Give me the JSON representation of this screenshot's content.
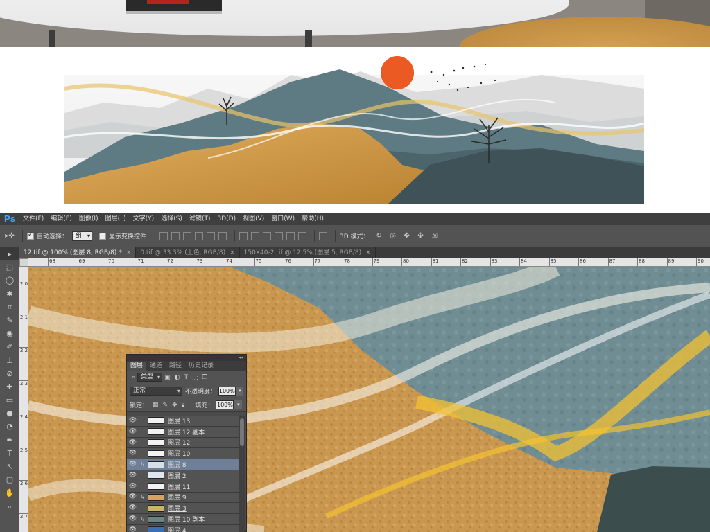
{
  "app": {
    "logo": "Ps"
  },
  "menu": [
    "文件(F)",
    "编辑(E)",
    "图像(I)",
    "图层(L)",
    "文字(Y)",
    "选择(S)",
    "滤镜(T)",
    "3D(D)",
    "视图(V)",
    "窗口(W)",
    "帮助(H)"
  ],
  "options_bar": {
    "auto_select_label": "自动选择：",
    "auto_select_value": "组",
    "show_transform_label": "显示变换控件",
    "mode3d_label": "3D 模式："
  },
  "tabs": [
    {
      "label": "12.tif @ 100% (图层 8, RGB/8) *",
      "active": true
    },
    {
      "label": "0.tif @ 33.3% (上色, RGB/8)",
      "active": false
    },
    {
      "label": "150X40-2.tif @ 12.5% (图层 5, RGB/8)",
      "active": false
    }
  ],
  "tab_close": "×",
  "ruler": {
    "h_labels": [
      "68",
      "69",
      "70",
      "71",
      "72",
      "73",
      "74",
      "75",
      "76",
      "77",
      "78",
      "79",
      "80",
      "81",
      "82",
      "83",
      "84",
      "85",
      "86",
      "87",
      "88",
      "89",
      "90"
    ],
    "v_labels": [
      "2 0",
      "2 1",
      "2 2",
      "2 3",
      "2 4",
      "2 5",
      "2 6",
      "2 7"
    ]
  },
  "tools": [
    "▸",
    "⬚",
    "◯",
    "✱",
    "⌗",
    "✎",
    "◉",
    "✐",
    "⊥",
    "⊘",
    "✚",
    "▭",
    "●",
    "◔",
    "✒",
    "T",
    "↖",
    "▢",
    "✋",
    "⌕"
  ],
  "layers_panel": {
    "collapse": "◂◂",
    "tabs": [
      "图层",
      "通道",
      "路径",
      "历史记录"
    ],
    "filter_label": "类型",
    "blend_mode": "正常",
    "opacity_label": "不透明度：",
    "opacity_value": "100%",
    "lock_label": "锁定：",
    "fill_label": "填充：",
    "fill_value": "100%",
    "layers": [
      {
        "name": "图层 13",
        "clip": false,
        "selected": false,
        "underline": false,
        "thumb": "#f2f2f2"
      },
      {
        "name": "图层 12 副本",
        "clip": false,
        "selected": false,
        "underline": false,
        "thumb": "#f2f2f2"
      },
      {
        "name": "图层 12",
        "clip": false,
        "selected": false,
        "underline": false,
        "thumb": "#f2f2f2"
      },
      {
        "name": "图层 10",
        "clip": false,
        "selected": false,
        "underline": false,
        "thumb": "#f2f2f2"
      },
      {
        "name": "图层 8",
        "clip": true,
        "selected": true,
        "underline": false,
        "thumb": "#d8dde6"
      },
      {
        "name": "图层 2",
        "clip": false,
        "selected": false,
        "underline": true,
        "thumb": "#e0e6f0"
      },
      {
        "name": "图层 11",
        "clip": false,
        "selected": false,
        "underline": false,
        "thumb": "#f2f2f2"
      },
      {
        "name": "图层 9",
        "clip": true,
        "selected": false,
        "underline": false,
        "thumb": "#d4a45e"
      },
      {
        "name": "图层 3",
        "clip": false,
        "selected": false,
        "underline": true,
        "thumb": "#c9b36e"
      },
      {
        "name": "图层 10 副本",
        "clip": true,
        "selected": false,
        "underline": false,
        "thumb": "#6b8286"
      },
      {
        "name": "图层 4",
        "clip": false,
        "selected": false,
        "underline": true,
        "thumb": "#3b6fb4"
      }
    ]
  }
}
